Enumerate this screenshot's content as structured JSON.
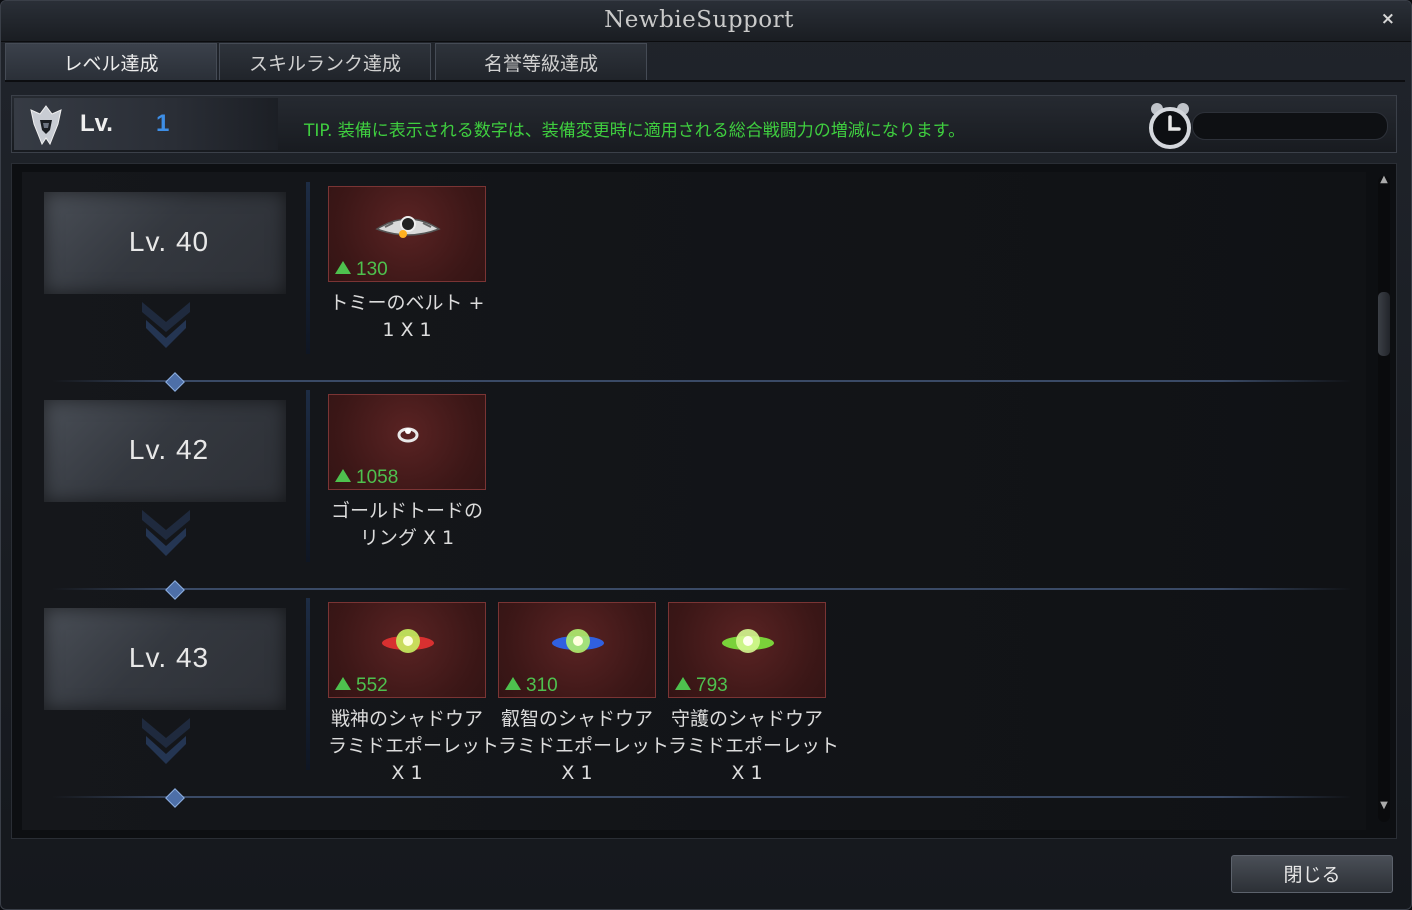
{
  "window": {
    "title": "NewbieSupport",
    "close_glyph": "×"
  },
  "tabs": [
    {
      "label": "レベル達成",
      "active": true
    },
    {
      "label": "スキルランク達成",
      "active": false
    },
    {
      "label": "名誉等級達成",
      "active": false
    }
  ],
  "level_bar": {
    "label": "Lv.",
    "value": "1",
    "tip": "TIP. 装備に表示される数字は、装備変更時に適用される総合戦闘力の増減になります。",
    "icons": [
      "helmet-emblem-icon",
      "alarm-clock-icon"
    ]
  },
  "rewards": [
    {
      "level": "Lv. 40",
      "items": [
        {
          "name_line1": "トミーのベルト +",
          "name_line2": "1 X 1",
          "name_line3": "",
          "value": "130",
          "icon": "belt-icon",
          "accent": "#ffb020"
        }
      ]
    },
    {
      "level": "Lv. 42",
      "items": [
        {
          "name_line1": "ゴールドトードの",
          "name_line2": "リング X 1",
          "name_line3": "",
          "value": "1058",
          "icon": "ring-icon",
          "accent": "#e8e8e8"
        }
      ]
    },
    {
      "level": "Lv. 43",
      "items": [
        {
          "name_line1": "戦神のシャドウア",
          "name_line2": "ラミドエポーレット",
          "name_line3": "X 1",
          "value": "552",
          "icon": "epaulette-red-icon",
          "accent": "#d83030"
        },
        {
          "name_line1": "叡智のシャドウア",
          "name_line2": "ラミドエポーレット",
          "name_line3": "X 1",
          "value": "310",
          "icon": "epaulette-blue-icon",
          "accent": "#3060e0"
        },
        {
          "name_line1": "守護のシャドウア",
          "name_line2": "ラミドエポーレット",
          "name_line3": "X 1",
          "value": "793",
          "icon": "epaulette-green-icon",
          "accent": "#7ad23a"
        }
      ]
    }
  ],
  "footer": {
    "close_label": "閉じる"
  },
  "colors": {
    "tip_text": "#3fce3f",
    "level_value": "#3d8ee6",
    "stat_up": "#4ec14e",
    "item_border": "#7a3434"
  }
}
